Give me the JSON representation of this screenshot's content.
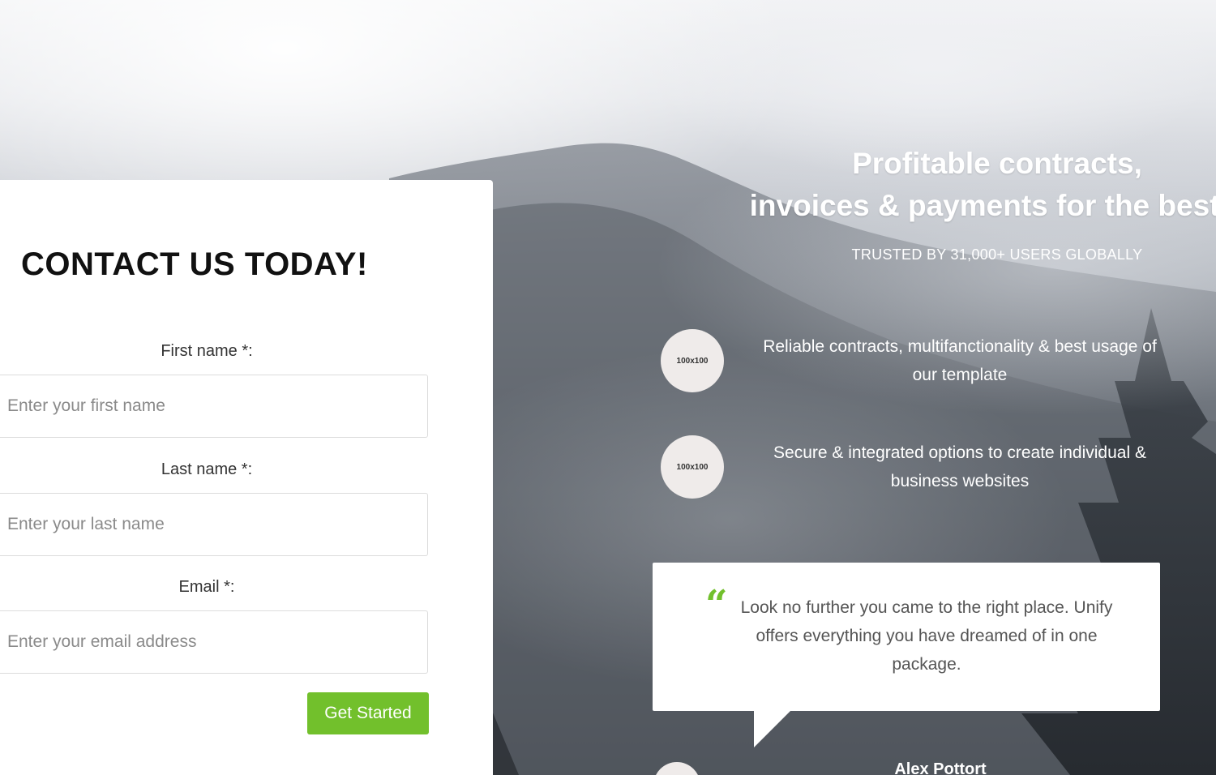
{
  "contact": {
    "title": "CONTACT US TODAY!",
    "fields": [
      {
        "label": "First name *:",
        "placeholder": "Enter your first name"
      },
      {
        "label": "Last name *:",
        "placeholder": "Enter your last name"
      },
      {
        "label": "Email *:",
        "placeholder": "Enter your email address"
      }
    ],
    "submit_label": "Get Started"
  },
  "hero": {
    "title_line1": "Profitable contracts,",
    "title_line2": "invoices & payments for the best c",
    "subtitle": "TRUSTED BY 31,000+ USERS GLOBALLY"
  },
  "features": [
    {
      "thumb": "100x100",
      "text": "Reliable contracts, multifanctionality & best usage of our template"
    },
    {
      "thumb": "100x100",
      "text": "Secure & integrated options to create individual & business websites"
    }
  ],
  "testimonial": {
    "quote_icon": "quote-open-icon",
    "text": "Look no further you came to the right place. Unify offers everything you have dreamed of in one package.",
    "author": "Alex Pottort"
  },
  "colors": {
    "accent": "#72c02c"
  }
}
